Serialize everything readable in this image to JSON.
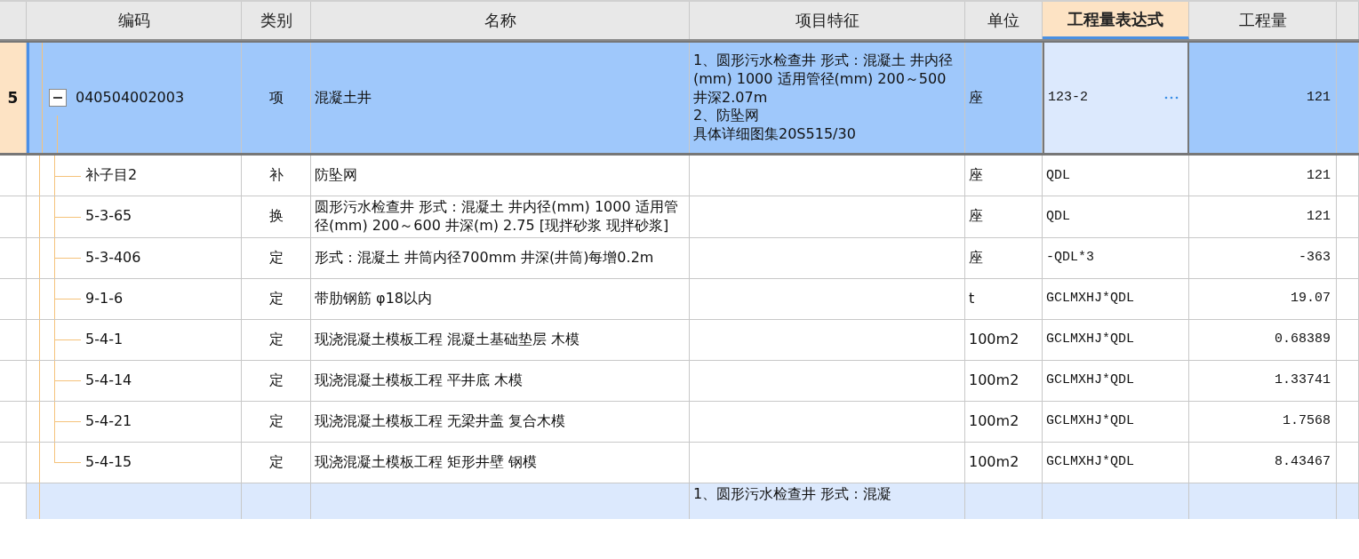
{
  "columns": [
    {
      "label": "编码",
      "selected": false
    },
    {
      "label": "类别",
      "selected": false
    },
    {
      "label": "名称",
      "selected": false
    },
    {
      "label": "项目特征",
      "selected": false
    },
    {
      "label": "单位",
      "selected": false
    },
    {
      "label": "工程量表达式",
      "selected": true
    },
    {
      "label": "工程量",
      "selected": false
    }
  ],
  "items": [
    {
      "row_number": "5",
      "code": "040504002003",
      "type": "项",
      "name": "混凝土井",
      "features": [
        "1、圆形污水检查井 形式：混凝土 井内径(mm) 1000 适用管径(mm) 200～500 井深2.07m",
        "2、防坠网",
        "具体详细图集20S515/30"
      ],
      "unit": "座",
      "expression": "123-2",
      "quantity": "121",
      "selected": true,
      "expanded": true,
      "children": [
        {
          "code": "补子目2",
          "type": "补",
          "name": "防坠网",
          "unit": "座",
          "expression": "QDL",
          "quantity": "121"
        },
        {
          "code": "5-3-65",
          "type": "换",
          "name": "圆形污水检查井 形式：混凝土 井内径(mm) 1000 适用管径(mm) 200～600 井深(m) 2.75 [现拌砂浆 现拌砂浆]",
          "unit": "座",
          "expression": "QDL",
          "quantity": "121"
        },
        {
          "code": "5-3-406",
          "type": "定",
          "name": "形式：混凝土 井筒内径700mm 井深(井筒)每增0.2m",
          "unit": "座",
          "expression": "-QDL*3",
          "quantity": "-363"
        },
        {
          "code": "9-1-6",
          "type": "定",
          "name": "带肋钢筋 φ18以内",
          "unit": "t",
          "expression": "GCLMXHJ*QDL",
          "quantity": "19.07"
        },
        {
          "code": "5-4-1",
          "type": "定",
          "name": "现浇混凝土模板工程 混凝土基础垫层 木模",
          "unit": "100m2",
          "expression": "GCLMXHJ*QDL",
          "quantity": "0.68389"
        },
        {
          "code": "5-4-14",
          "type": "定",
          "name": "现浇混凝土模板工程 平井底 木模",
          "unit": "100m2",
          "expression": "GCLMXHJ*QDL",
          "quantity": "1.33741"
        },
        {
          "code": "5-4-21",
          "type": "定",
          "name": "现浇混凝土模板工程 无梁井盖 复合木模",
          "unit": "100m2",
          "expression": "GCLMXHJ*QDL",
          "quantity": "1.7568"
        },
        {
          "code": "5-4-15",
          "type": "定",
          "name": "现浇混凝土模板工程 矩形井壁 钢模",
          "unit": "100m2",
          "expression": "GCLMXHJ*QDL",
          "quantity": "8.43467"
        }
      ]
    },
    {
      "features": [
        "1、圆形污水检查井 形式：混凝"
      ],
      "selected": false
    }
  ]
}
